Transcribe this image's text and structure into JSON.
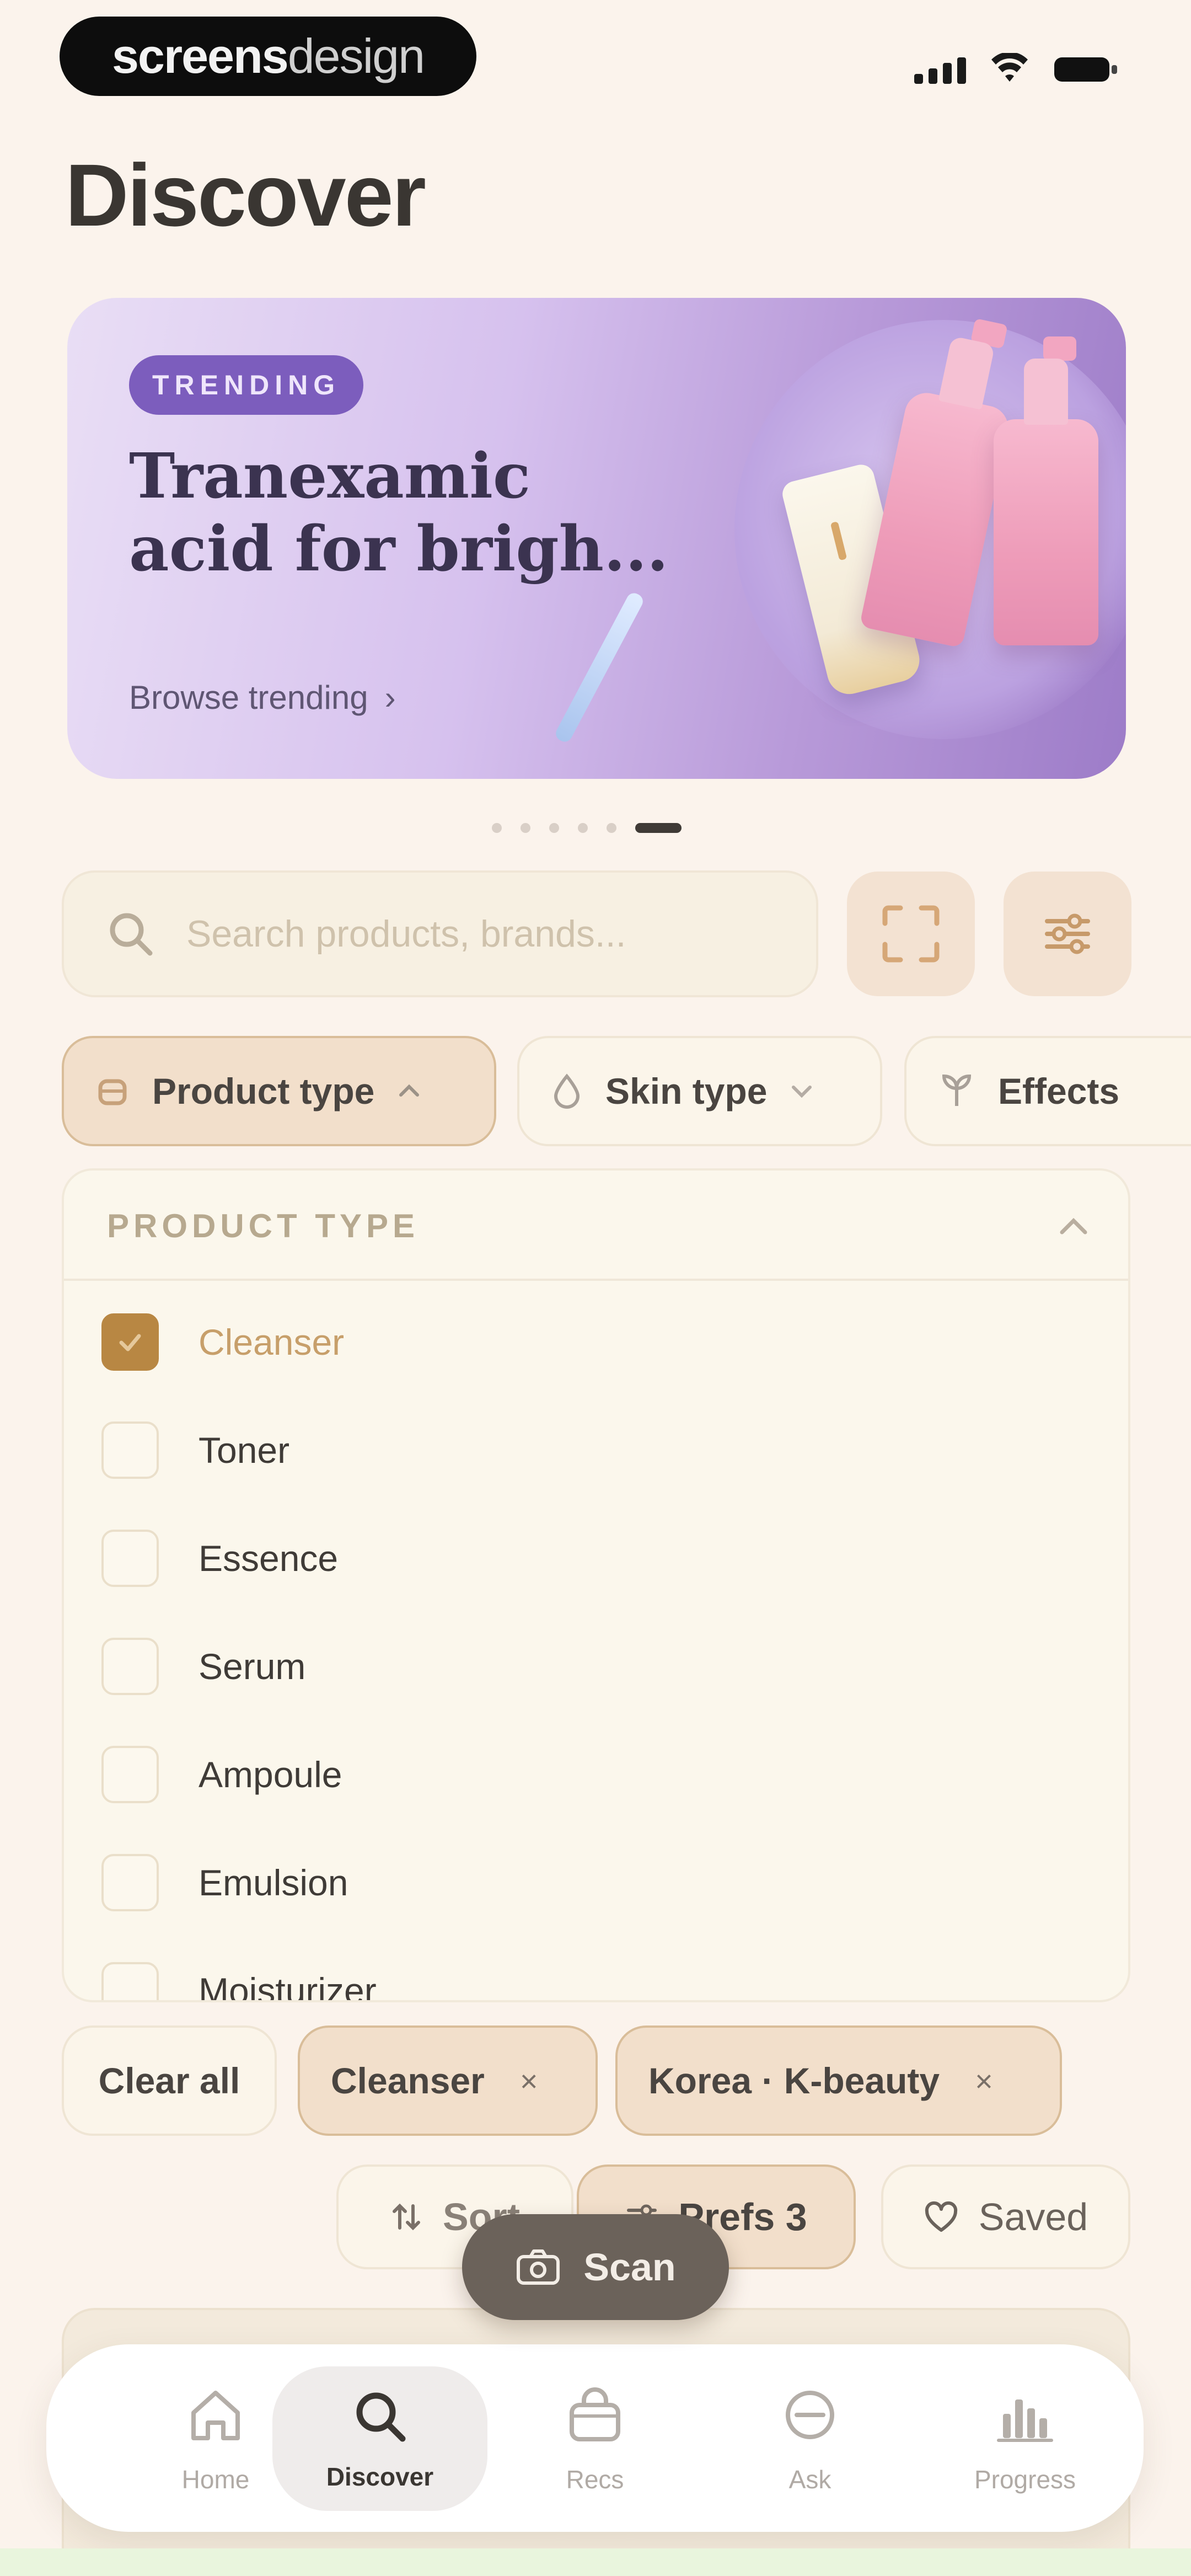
{
  "status_bar": {
    "brand_bold": "screens",
    "brand_light": "design"
  },
  "page": {
    "title": "Discover"
  },
  "banner": {
    "badge": "TRENDING",
    "title_line1": "Tranexamic",
    "title_line2": "acid for brigh...",
    "link": "Browse trending",
    "link_chevron": "›",
    "pages_total": 6,
    "page_active": 6
  },
  "search": {
    "placeholder": "Search products, brands..."
  },
  "filters": [
    {
      "label": "Product type",
      "icon": "bottle-icon",
      "expanded": true
    },
    {
      "label": "Skin type",
      "icon": "drop-icon",
      "expanded": false
    },
    {
      "label": "Effects",
      "icon": "sparkle-icon",
      "expanded": false
    }
  ],
  "dropdown": {
    "title": "PRODUCT TYPE",
    "options": [
      {
        "label": "Cleanser",
        "checked": true
      },
      {
        "label": "Toner",
        "checked": false
      },
      {
        "label": "Essence",
        "checked": false
      },
      {
        "label": "Serum",
        "checked": false
      },
      {
        "label": "Ampoule",
        "checked": false
      },
      {
        "label": "Emulsion",
        "checked": false
      },
      {
        "label": "Moisturizer",
        "checked": false
      }
    ]
  },
  "active_tags": {
    "clear_all": "Clear all",
    "tags": [
      "Cleanser",
      "Korea · K-beauty"
    ],
    "remove_glyph": "×"
  },
  "actions": {
    "sort": "Sort",
    "prefs": "Prefs 3",
    "saved": "Saved"
  },
  "fab": {
    "label": "Scan"
  },
  "nav": [
    {
      "label": "Home",
      "active": false
    },
    {
      "label": "Discover",
      "active": true
    },
    {
      "label": "Recs",
      "active": false
    },
    {
      "label": "Ask",
      "active": false
    },
    {
      "label": "Progress",
      "active": false
    }
  ],
  "colors": {
    "background": "#fbf3ec",
    "accent_purple": "#7c5dbd",
    "checkbox_checked": "#b88743",
    "chip_active": "#f2dfcb",
    "fab": "#6b625a"
  }
}
